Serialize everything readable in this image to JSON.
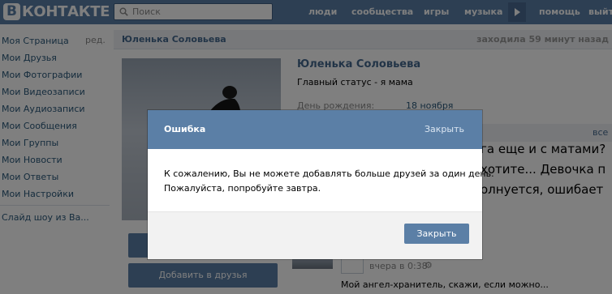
{
  "header": {
    "logo_letter": "В",
    "logo_text": "КОНТАКТЕ",
    "search_placeholder": "Поиск",
    "nav": [
      "люди",
      "сообщества",
      "игры",
      "музыка",
      "помощь",
      "выйти"
    ],
    "accent_color": "#5b7fa6"
  },
  "sidebar": {
    "items": [
      {
        "label": "Моя Страница"
      },
      {
        "label": "Мои Друзья"
      },
      {
        "label": "Мои Фотографии"
      },
      {
        "label": "Мои Видеозаписи"
      },
      {
        "label": "Мои Аудиозаписи"
      },
      {
        "label": "Мои Сообщения"
      },
      {
        "label": "Мои Группы"
      },
      {
        "label": "Мои Новости"
      },
      {
        "label": "Мои Ответы"
      },
      {
        "label": "Мои Настройки"
      }
    ],
    "edit_label": "ред.",
    "extra_item": "Слайд шоу из Ва..."
  },
  "page_header": {
    "name": "Юленька Соловьева",
    "last_seen": "заходила 59 минут назад"
  },
  "profile": {
    "name": "Юленька Соловьева",
    "status": "Главный статус - я мама",
    "birthday_label": "День рождения:",
    "birthday_value": "18 ноября",
    "add_friend_label": "Добавить в друзья",
    "section_all": "все",
    "text_line1": "га еще и с матами?",
    "text_line2": "хотите... Девочка п",
    "text_line3": "олнуется, ошибает"
  },
  "wall": {
    "time": "вчера в 0:38",
    "post_text": "Мой ангел-хранитель, скажи, если можно..."
  },
  "modal": {
    "title": "Ошибка",
    "close_link": "Закрыть",
    "message_line1": "К сожалению, Вы не можете добавлять больше друзей за один день.",
    "message_line2": "Пожалуйста, попробуйте завтра.",
    "button_label": "Закрыть"
  }
}
